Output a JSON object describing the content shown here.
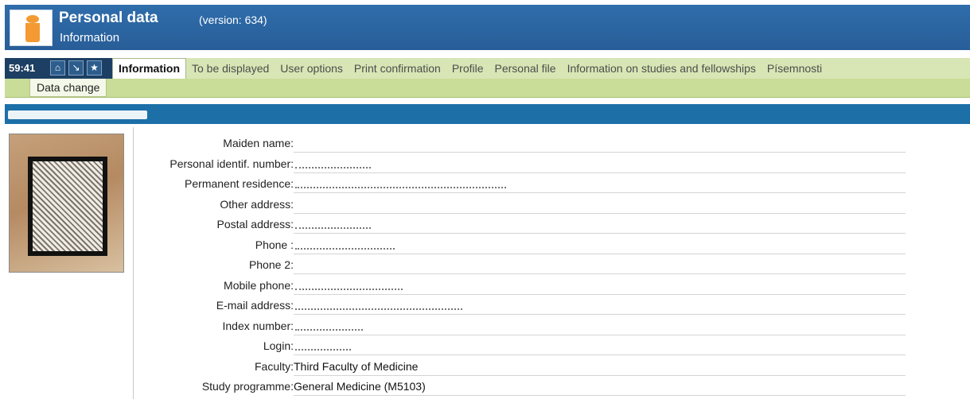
{
  "header": {
    "title": "Personal data",
    "version": "(version: 634)",
    "subtitle": "Information"
  },
  "toolbar": {
    "clock": "59:41",
    "icons": [
      "home-icon",
      "bookmark-down-icon",
      "star-icon"
    ]
  },
  "tabs": [
    {
      "label": "Information",
      "active": true
    },
    {
      "label": "To be displayed"
    },
    {
      "label": "User options"
    },
    {
      "label": "Print confirmation"
    },
    {
      "label": "Profile"
    },
    {
      "label": "Personal file"
    },
    {
      "label": "Information on studies and fellowships"
    },
    {
      "label": "Písemnosti"
    }
  ],
  "subtabs": [
    {
      "label": "Data change"
    }
  ],
  "person": {
    "fields": [
      {
        "label": "Maiden name:",
        "value": ""
      },
      {
        "label": "Personal identif. number:",
        "value": ""
      },
      {
        "label": "Permanent residence:",
        "value": ""
      },
      {
        "label": "Other address:",
        "value": ""
      },
      {
        "label": "Postal address:",
        "value": ""
      },
      {
        "label": "Phone :",
        "value": ""
      },
      {
        "label": "Phone 2:",
        "value": ""
      },
      {
        "label": "Mobile phone:",
        "value": ""
      },
      {
        "label": "E-mail address:",
        "value": ""
      },
      {
        "label": "Index number:",
        "value": ""
      },
      {
        "label": "Login:",
        "value": ""
      },
      {
        "label": "Faculty:",
        "value": "Third Faculty of Medicine"
      },
      {
        "label": "Study programme:",
        "value": "General Medicine (M5103)"
      }
    ]
  },
  "colors": {
    "header_blue": "#2f6dab",
    "tab_green": "#d7e6b4",
    "namebar_blue": "#1d6fa8",
    "icon_orange": "#f39a33"
  }
}
